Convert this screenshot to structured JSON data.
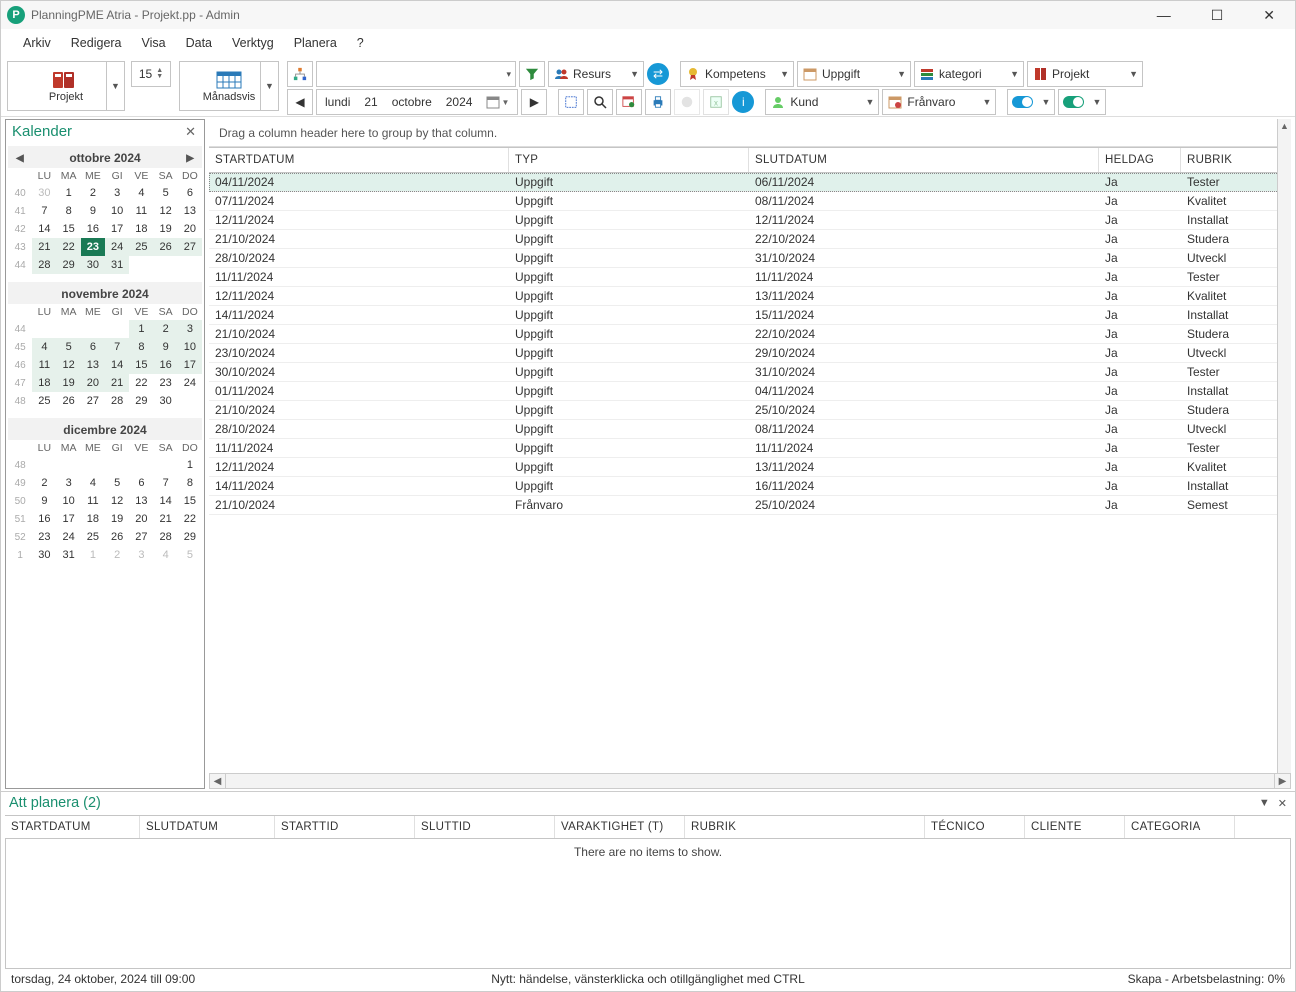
{
  "title": "PlanningPME Atria - Projekt.pp - Admin",
  "menu": [
    "Arkiv",
    "Redigera",
    "Visa",
    "Data",
    "Verktyg",
    "Planera",
    "?"
  ],
  "toolbar": {
    "projekt": "Projekt",
    "manadsvis": "Månadsvis",
    "spin": "15",
    "date_nav": {
      "weekday": "lundi",
      "day": "21",
      "month": "octobre",
      "year": "2024"
    },
    "filters": {
      "resurs": "Resurs",
      "kompetens": "Kompetens",
      "uppgift": "Uppgift",
      "kategori": "kategori",
      "projekt": "Projekt",
      "kund": "Kund",
      "franvaro": "Frånvaro"
    }
  },
  "sidebar": {
    "title": "Kalender",
    "dow": [
      "LU",
      "MA",
      "ME",
      "GI",
      "VE",
      "SA",
      "DO"
    ],
    "months": [
      {
        "label": "ottobre 2024",
        "nav": true,
        "rows": [
          {
            "wk": "40",
            "d": [
              "30",
              "1",
              "2",
              "3",
              "4",
              "5",
              "6"
            ],
            "dim": [
              0
            ]
          },
          {
            "wk": "41",
            "d": [
              "7",
              "8",
              "9",
              "10",
              "11",
              "12",
              "13"
            ]
          },
          {
            "wk": "42",
            "d": [
              "14",
              "15",
              "16",
              "17",
              "18",
              "19",
              "20"
            ]
          },
          {
            "wk": "43",
            "d": [
              "21",
              "22",
              "23",
              "24",
              "25",
              "26",
              "27"
            ],
            "shade": [
              0,
              1,
              2,
              3,
              4,
              5,
              6
            ],
            "today": 2
          },
          {
            "wk": "44",
            "d": [
              "28",
              "29",
              "30",
              "31",
              "",
              "",
              ""
            ],
            "shade": [
              0,
              1,
              2,
              3
            ]
          }
        ]
      },
      {
        "label": "novembre 2024",
        "rows": [
          {
            "wk": "44",
            "d": [
              "",
              "",
              "",
              "",
              "1",
              "2",
              "3"
            ],
            "shade": [
              4,
              5,
              6
            ]
          },
          {
            "wk": "45",
            "d": [
              "4",
              "5",
              "6",
              "7",
              "8",
              "9",
              "10"
            ],
            "shade": [
              0,
              1,
              2,
              3,
              4,
              5,
              6
            ]
          },
          {
            "wk": "46",
            "d": [
              "11",
              "12",
              "13",
              "14",
              "15",
              "16",
              "17"
            ],
            "shade": [
              0,
              1,
              2,
              3,
              4,
              5,
              6
            ]
          },
          {
            "wk": "47",
            "d": [
              "18",
              "19",
              "20",
              "21",
              "22",
              "23",
              "24"
            ],
            "shade": [
              0,
              1,
              2,
              3
            ]
          },
          {
            "wk": "48",
            "d": [
              "25",
              "26",
              "27",
              "28",
              "29",
              "30",
              ""
            ]
          }
        ]
      },
      {
        "label": "dicembre 2024",
        "rows": [
          {
            "wk": "48",
            "d": [
              "",
              "",
              "",
              "",
              "",
              "",
              "1"
            ]
          },
          {
            "wk": "49",
            "d": [
              "2",
              "3",
              "4",
              "5",
              "6",
              "7",
              "8"
            ]
          },
          {
            "wk": "50",
            "d": [
              "9",
              "10",
              "11",
              "12",
              "13",
              "14",
              "15"
            ]
          },
          {
            "wk": "51",
            "d": [
              "16",
              "17",
              "18",
              "19",
              "20",
              "21",
              "22"
            ]
          },
          {
            "wk": "52",
            "d": [
              "23",
              "24",
              "25",
              "26",
              "27",
              "28",
              "29"
            ]
          },
          {
            "wk": "1",
            "d": [
              "30",
              "31",
              "1",
              "2",
              "3",
              "4",
              "5"
            ],
            "dim": [
              2,
              3,
              4,
              5,
              6
            ]
          }
        ]
      }
    ]
  },
  "grid": {
    "group_hint": "Drag a column header here to group by that column.",
    "cols": [
      "STARTDATUM",
      "TYP",
      "SLUTDATUM",
      "HELDAG",
      "RUBRIK"
    ],
    "rows": [
      {
        "s": "04/11/2024",
        "t": "Uppgift",
        "e": "06/11/2024",
        "h": "Ja",
        "r": "Tester",
        "sel": true
      },
      {
        "s": "07/11/2024",
        "t": "Uppgift",
        "e": "08/11/2024",
        "h": "Ja",
        "r": "Kvalitet"
      },
      {
        "s": "12/11/2024",
        "t": "Uppgift",
        "e": "12/11/2024",
        "h": "Ja",
        "r": "Installat"
      },
      {
        "s": "21/10/2024",
        "t": "Uppgift",
        "e": "22/10/2024",
        "h": "Ja",
        "r": "Studera"
      },
      {
        "s": "28/10/2024",
        "t": "Uppgift",
        "e": "31/10/2024",
        "h": "Ja",
        "r": "Utveckl"
      },
      {
        "s": "11/11/2024",
        "t": "Uppgift",
        "e": "11/11/2024",
        "h": "Ja",
        "r": "Tester"
      },
      {
        "s": "12/11/2024",
        "t": "Uppgift",
        "e": "13/11/2024",
        "h": "Ja",
        "r": "Kvalitet"
      },
      {
        "s": "14/11/2024",
        "t": "Uppgift",
        "e": "15/11/2024",
        "h": "Ja",
        "r": "Installat"
      },
      {
        "s": "21/10/2024",
        "t": "Uppgift",
        "e": "22/10/2024",
        "h": "Ja",
        "r": "Studera"
      },
      {
        "s": "23/10/2024",
        "t": "Uppgift",
        "e": "29/10/2024",
        "h": "Ja",
        "r": "Utveckl"
      },
      {
        "s": "30/10/2024",
        "t": "Uppgift",
        "e": "31/10/2024",
        "h": "Ja",
        "r": "Tester"
      },
      {
        "s": "01/11/2024",
        "t": "Uppgift",
        "e": "04/11/2024",
        "h": "Ja",
        "r": "Installat"
      },
      {
        "s": "21/10/2024",
        "t": "Uppgift",
        "e": "25/10/2024",
        "h": "Ja",
        "r": "Studera"
      },
      {
        "s": "28/10/2024",
        "t": "Uppgift",
        "e": "08/11/2024",
        "h": "Ja",
        "r": "Utveckl"
      },
      {
        "s": "11/11/2024",
        "t": "Uppgift",
        "e": "11/11/2024",
        "h": "Ja",
        "r": "Tester"
      },
      {
        "s": "12/11/2024",
        "t": "Uppgift",
        "e": "13/11/2024",
        "h": "Ja",
        "r": "Kvalitet"
      },
      {
        "s": "14/11/2024",
        "t": "Uppgift",
        "e": "16/11/2024",
        "h": "Ja",
        "r": "Installat"
      },
      {
        "s": "21/10/2024",
        "t": "Frånvaro",
        "e": "25/10/2024",
        "h": "Ja",
        "r": "Semest"
      }
    ]
  },
  "bottom": {
    "title": "Att planera (2)",
    "cols": [
      "STARTDATUM",
      "SLUTDATUM",
      "STARTTID",
      "SLUTTID",
      "VARAKTIGHET (T)",
      "RUBRIK",
      "TÉCNICO",
      "CLIENTE",
      "CATEGORIA"
    ],
    "empty": "There are no items to show."
  },
  "status": {
    "left": "torsdag, 24 oktober, 2024 till 09:00",
    "mid": "Nytt: händelse, vänsterklicka och otillgänglighet med CTRL",
    "right": "Skapa - Arbetsbelastning: 0%"
  }
}
